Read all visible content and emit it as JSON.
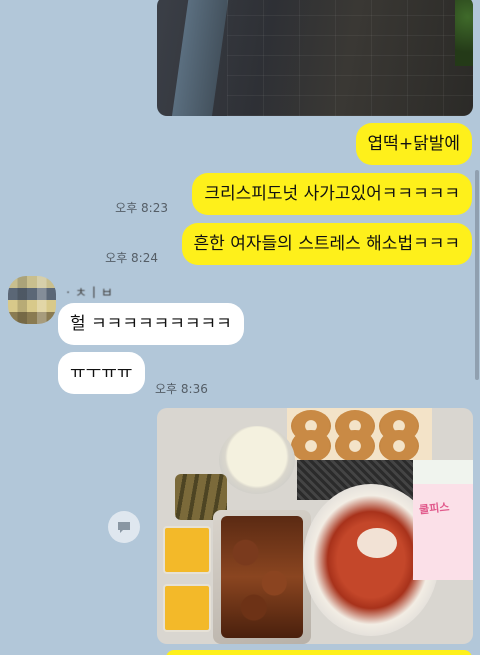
{
  "messages": [
    {
      "id": "m1",
      "text": "엽떡+닭발에",
      "time": ""
    },
    {
      "id": "m2",
      "text": "크리스피도넛 사가고있어ㅋㅋㅋㅋㅋ",
      "time": "오후 8:23"
    },
    {
      "id": "m3",
      "text": "흔한 여자들의 스트레스 해소법ㅋㅋㅋ",
      "time": "오후 8:24"
    },
    {
      "id": "m4",
      "text": "헐 ㅋㅋㅋㅋㅋㅋㅋㅋㅋ",
      "time": ""
    },
    {
      "id": "m5",
      "text": "ㅠㅜㅠㅠ",
      "time": "오후 8:36"
    }
  ],
  "sender_name": "ㆍㅊㅣㅂ",
  "photo_food": {
    "milk_label": "쿨피스"
  },
  "colors": {
    "background": "#b2c7d9",
    "outgoing": "#fef01b",
    "incoming": "#ffffff"
  },
  "icons": {
    "share": "share-icon"
  }
}
